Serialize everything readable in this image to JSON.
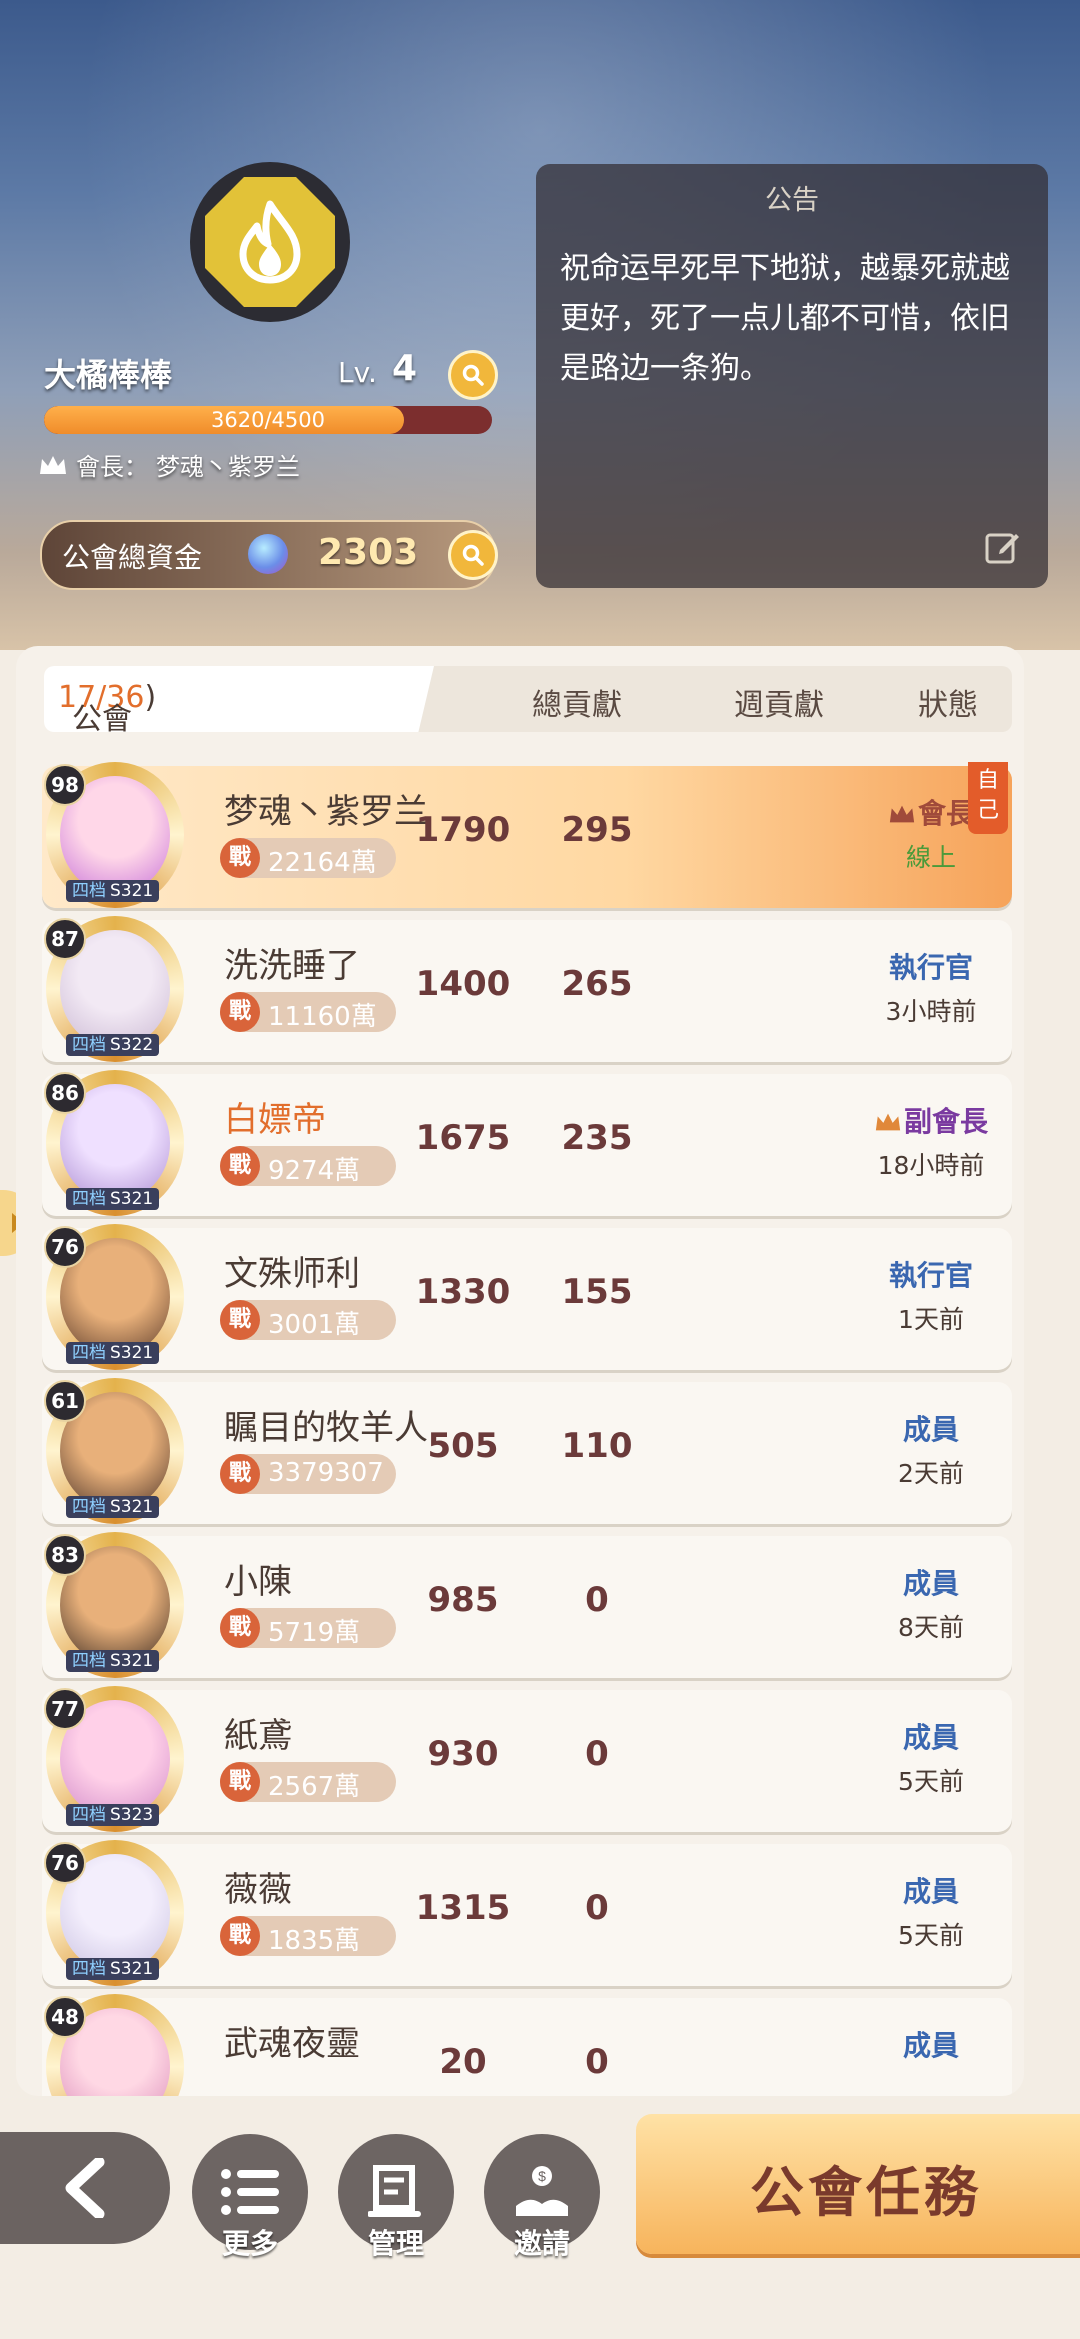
{
  "guild": {
    "name": "大橘棒棒",
    "level_label": "Lv.",
    "level": "4",
    "exp_text": "3620/4500",
    "exp_progress": 0.804,
    "leader_label": "會長：",
    "leader_name": "梦魂丶紫罗兰",
    "funds_label": "公會總資金",
    "funds_value": "2303"
  },
  "notice": {
    "title": "公告",
    "body": "祝命运早死早下地狱，越暴死就越更好，死了一点儿都不可惜，依旧是路边一条狗。"
  },
  "members_header": {
    "title": "公會成員：(",
    "count": "17/36",
    "close": ")",
    "col_total": "總貢獻",
    "col_week": "週貢獻",
    "col_status": "狀態"
  },
  "members": [
    {
      "level": "98",
      "server": "S321",
      "name": "梦魂丶紫罗兰",
      "power": "22164萬",
      "total": "1790",
      "week": "295",
      "role": "會長",
      "status": "線上",
      "self": true
    },
    {
      "level": "87",
      "server": "S322",
      "name": "洗洗睡了",
      "power": "11160萬",
      "total": "1400",
      "week": "265",
      "role": "執行官",
      "status": "3小時前"
    },
    {
      "level": "86",
      "server": "S321",
      "name": "白嫖帝",
      "power": "9274萬",
      "total": "1675",
      "week": "235",
      "role": "副會長",
      "status": "18小時前"
    },
    {
      "level": "76",
      "server": "S321",
      "name": "文殊师利",
      "power": "3001萬",
      "total": "1330",
      "week": "155",
      "role": "執行官",
      "status": "1天前"
    },
    {
      "level": "61",
      "server": "S321",
      "name": "瞩目的牧羊人",
      "power": "3379307",
      "total": "505",
      "week": "110",
      "role": "成員",
      "status": "2天前"
    },
    {
      "level": "83",
      "server": "S321",
      "name": "小陳",
      "power": "5719萬",
      "total": "985",
      "week": "0",
      "role": "成員",
      "status": "8天前"
    },
    {
      "level": "77",
      "server": "S323",
      "name": "紙鳶",
      "power": "2567萬",
      "total": "930",
      "week": "0",
      "role": "成員",
      "status": "5天前"
    },
    {
      "level": "76",
      "server": "S321",
      "name": "薇薇",
      "power": "1835萬",
      "total": "1315",
      "week": "0",
      "role": "成員",
      "status": "5天前"
    },
    {
      "level": "48",
      "server": "",
      "name": "武魂夜靈",
      "power": "",
      "total": "20",
      "week": "0",
      "role": "成員",
      "status": ""
    }
  ],
  "labels": {
    "server_prefix": "四档",
    "power_icon": "戰",
    "self_tag": "自己"
  },
  "bottom": {
    "more": "更多",
    "manage": "管理",
    "invite": "邀請",
    "quest": "公會任務"
  },
  "colors": {
    "accent_orange": "#f08c2a",
    "role_blue": "#3a67b0",
    "leader_red": "#a04a3a",
    "vice_purple": "#7a3aa0",
    "online_green": "#4a9a3a"
  }
}
